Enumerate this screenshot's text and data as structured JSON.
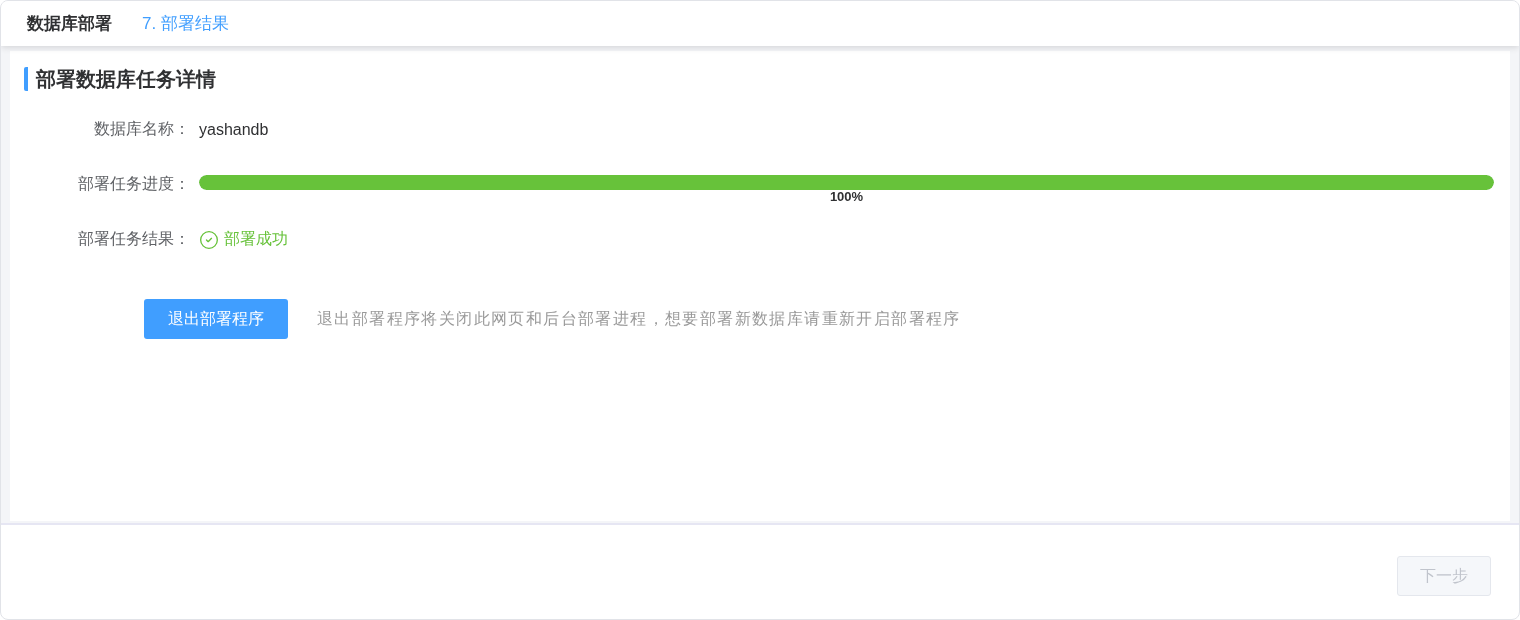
{
  "header": {
    "title": "数据库部署",
    "step": "7. 部署结果"
  },
  "section": {
    "title": "部署数据库任务详情"
  },
  "fields": [
    {
      "kind": "text",
      "label": "数据库名称：",
      "value": "yashandb"
    },
    {
      "kind": "progress",
      "label": "部署任务进度：",
      "level": 1,
      "reading": "100%"
    },
    {
      "kind": "status",
      "label": "部署任务结果：",
      "value": "部署成功",
      "success": true
    }
  ],
  "actions": {
    "button": "退出部署程序",
    "hint": "退出部署程序将关闭此网页和后台部署进程，想要部署新数据库请重新开启部署程序"
  },
  "footer": {
    "next_button": {
      "label": "下一步",
      "disabled": true
    }
  }
}
